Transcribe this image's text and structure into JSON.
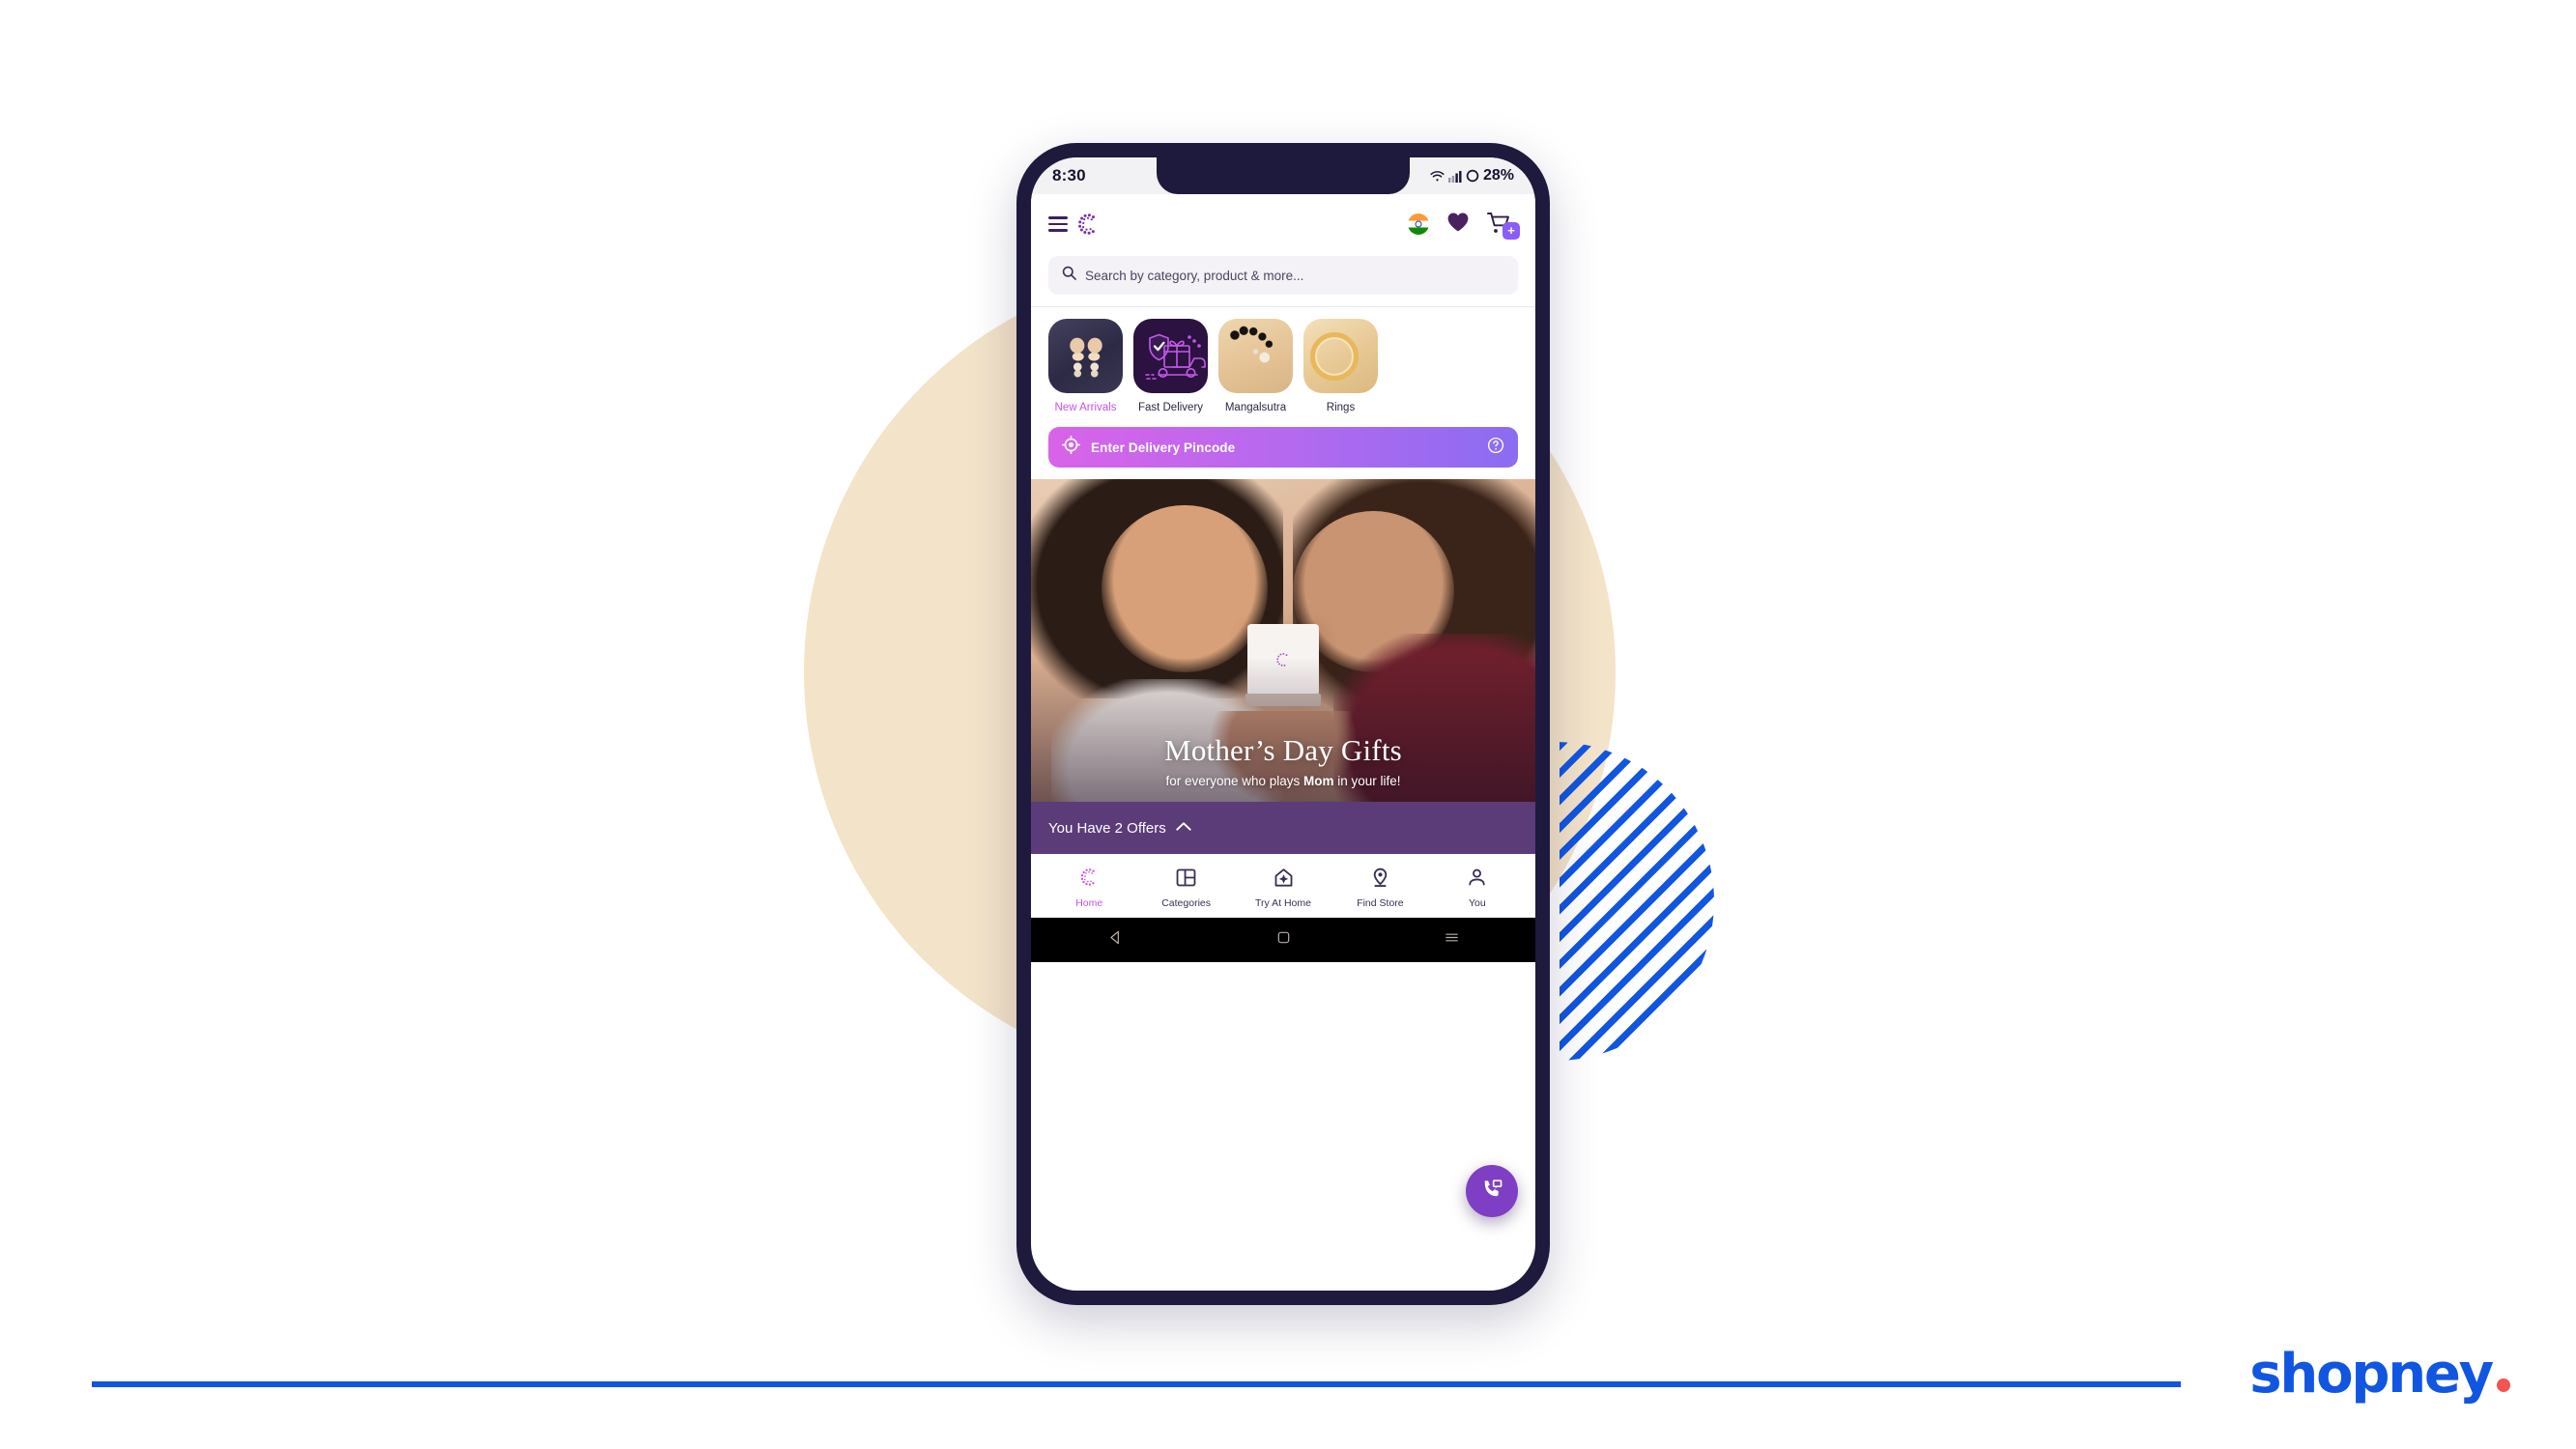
{
  "status_bar": {
    "time": "8:30",
    "battery_percent": "28%",
    "icons": [
      "wifi-icon",
      "cellular-signal-icon",
      "battery-circle-icon"
    ]
  },
  "app_header": {
    "menu_icon": "hamburger-menu-icon",
    "brand_icon": "caratlane-dotted-c-logo",
    "flag_icon": "india-flag-icon",
    "wishlist_icon": "heart-icon",
    "cart_icon": "shopping-cart-icon",
    "cart_badge": "+"
  },
  "search": {
    "placeholder": "Search by category, product & more...",
    "icon": "search-icon"
  },
  "categories": [
    {
      "label": "New Arrivals",
      "art": "t-earrings",
      "active": true
    },
    {
      "label": "Fast Delivery",
      "art": "t-delivery",
      "active": false
    },
    {
      "label": "Mangalsutra",
      "art": "t-mangalsutra",
      "active": false
    },
    {
      "label": "Rings",
      "art": "t-rings",
      "active": false
    }
  ],
  "pincode": {
    "label": "Enter Delivery Pincode",
    "location_icon": "crosshair-location-icon",
    "help_icon": "help-circle-icon",
    "gradient_from": "#d963e8",
    "gradient_to": "#8b6cf2"
  },
  "hero": {
    "title": "Mother’s Day Gifts",
    "subtitle_before": "for everyone who plays ",
    "subtitle_bold": "Mom",
    "subtitle_after": " in your life!"
  },
  "fab": {
    "icon": "phone-chat-support-icon",
    "color": "#7e3fc4"
  },
  "offers": {
    "label": "You Have 2 Offers",
    "chevron_icon": "chevron-up-icon",
    "bar_color": "#5c3b79"
  },
  "bottom_nav": [
    {
      "label": "Home",
      "icon": "dotted-c-home-icon",
      "active": true
    },
    {
      "label": "Categories",
      "icon": "grid-layout-icon",
      "active": false
    },
    {
      "label": "Try At Home",
      "icon": "house-sparkle-icon",
      "active": false
    },
    {
      "label": "Find Store",
      "icon": "map-pin-icon",
      "active": false
    },
    {
      "label": "You",
      "icon": "person-icon",
      "active": false
    }
  ],
  "android_nav": [
    {
      "icon": "back-triangle-icon"
    },
    {
      "icon": "home-square-icon"
    },
    {
      "icon": "recents-menu-icon"
    }
  ],
  "footer": {
    "brand": "shopney",
    "brand_color": "#1156e0",
    "dot_color": "#f2544f",
    "rule_color": "#1156e0"
  },
  "decor": {
    "beige_circle_color": "#f3e3c9",
    "stripe_color": "#1156e0",
    "phone_frame_color": "#1d1a3d"
  }
}
